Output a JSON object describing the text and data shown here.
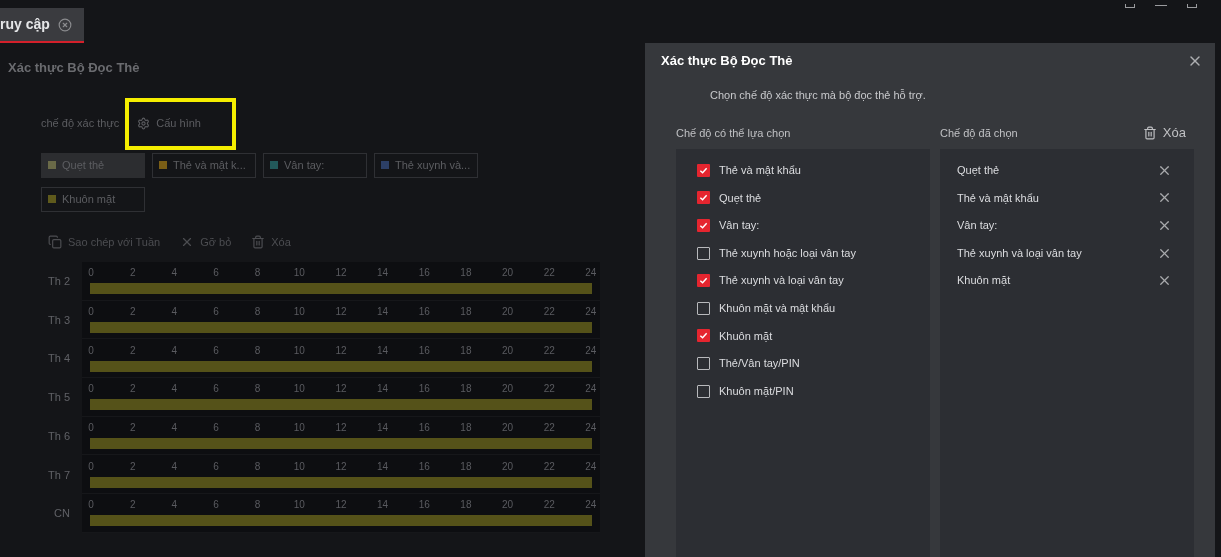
{
  "tab": {
    "label": "ruy cập",
    "selected": true
  },
  "page": {
    "title": "Xác thực Bộ Đọc Thẻ",
    "mode_label": "chế độ xác thực",
    "config_button": "Cấu hình",
    "config_highlighted": true,
    "modes": [
      {
        "label": "Quẹt thẻ",
        "color": "#6a6a48",
        "selected": true
      },
      {
        "label": "Thẻ và mật k...",
        "color": "#7a5e16",
        "selected": false
      },
      {
        "label": "Vân tay:",
        "color": "#22595a",
        "selected": false
      },
      {
        "label": "Thẻ xuynh và...",
        "color": "#2c3f66",
        "selected": false
      },
      {
        "label": "Khuôn mặt",
        "color": "#5f5a1c",
        "selected": false
      }
    ],
    "toolbar": [
      {
        "kind": "copy",
        "label": "Sao chép với Tuần"
      },
      {
        "kind": "remove",
        "label": "Gỡ bỏ"
      },
      {
        "kind": "delete",
        "label": "Xóa"
      }
    ],
    "schedule": [
      {
        "day": "Th 2",
        "ticks": [
          "0",
          "2",
          "4",
          "6",
          "8",
          "10",
          "12",
          "14",
          "16",
          "18",
          "20",
          "22",
          "24"
        ],
        "level": 1
      },
      {
        "day": "Th 3",
        "ticks": [
          "0",
          "2",
          "4",
          "6",
          "8",
          "10",
          "12",
          "14",
          "16",
          "18",
          "20",
          "22",
          "24"
        ],
        "level": 1
      },
      {
        "day": "Th 4",
        "ticks": [
          "0",
          "2",
          "4",
          "6",
          "8",
          "10",
          "12",
          "14",
          "16",
          "18",
          "20",
          "22",
          "24"
        ],
        "level": 1
      },
      {
        "day": "Th 5",
        "ticks": [
          "0",
          "2",
          "4",
          "6",
          "8",
          "10",
          "12",
          "14",
          "16",
          "18",
          "20",
          "22",
          "24"
        ],
        "level": 1
      },
      {
        "day": "Th 6",
        "ticks": [
          "0",
          "2",
          "4",
          "6",
          "8",
          "10",
          "12",
          "14",
          "16",
          "18",
          "20",
          "22",
          "24"
        ],
        "level": 1
      },
      {
        "day": "Th 7",
        "ticks": [
          "0",
          "2",
          "4",
          "6",
          "8",
          "10",
          "12",
          "14",
          "16",
          "18",
          "20",
          "22",
          "24"
        ],
        "level": 1
      },
      {
        "day": "CN",
        "ticks": [
          "0",
          "2",
          "4",
          "6",
          "8",
          "10",
          "12",
          "14",
          "16",
          "18",
          "20",
          "22",
          "24"
        ],
        "level": 1
      }
    ]
  },
  "dialog": {
    "title": "Xác thực Bộ Đọc Thẻ",
    "subtitle": "Chọn chế độ xác thực mà bộ đọc thẻ hỗ trợ.",
    "available_header": "Chế độ có thể lựa chọn",
    "selected_header": "Chế độ đã chọn",
    "clear_button": "Xóa",
    "available": [
      {
        "label": "Thẻ và mật khẩu",
        "checked": true
      },
      {
        "label": "Quẹt thẻ",
        "checked": true
      },
      {
        "label": "Vân tay:",
        "checked": true
      },
      {
        "label": "Thẻ xuynh hoặc loại vân tay",
        "checked": false
      },
      {
        "label": "Thẻ xuynh và loại vân tay",
        "checked": true
      },
      {
        "label": "Khuôn mặt và mật khẩu",
        "checked": false
      },
      {
        "label": "Khuôn mặt",
        "checked": true
      },
      {
        "label": "Thẻ/Vân tay/PIN",
        "checked": false
      },
      {
        "label": "Khuôn mặt/PIN",
        "checked": false
      }
    ],
    "selected": [
      "Quẹt thẻ",
      "Thẻ và mật khẩu",
      "Vân tay:",
      "Thẻ xuynh và loại vân tay",
      "Khuôn mặt"
    ]
  }
}
